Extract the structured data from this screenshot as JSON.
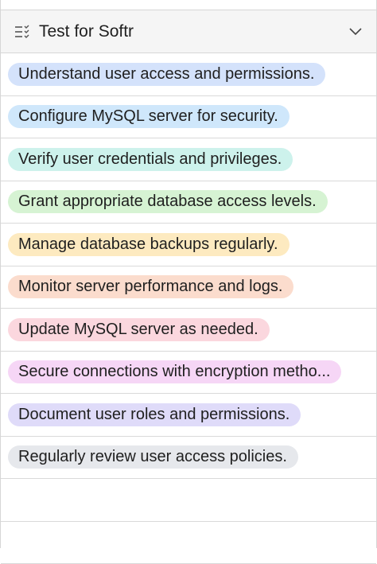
{
  "column": {
    "title": "Test for Softr",
    "icon": "multi-select-field-icon",
    "menu_icon": "chevron-down-icon"
  },
  "rows": [
    {
      "label": "Understand user access and permissions.",
      "color": "#d4e2fb"
    },
    {
      "label": "Configure MySQL server for security.",
      "color": "#cfe7fb"
    },
    {
      "label": "Verify user credentials and privileges.",
      "color": "#cdf2ec"
    },
    {
      "label": "Grant appropriate database access levels.",
      "color": "#d6f3d3"
    },
    {
      "label": "Manage database backups regularly.",
      "color": "#fdeac0"
    },
    {
      "label": "Monitor server performance and logs.",
      "color": "#fbdccd"
    },
    {
      "label": "Update MySQL server as needed.",
      "color": "#fbd7de"
    },
    {
      "label": "Secure connections with encryption metho...",
      "color": "#f6d6f6"
    },
    {
      "label": "Document user roles and permissions.",
      "color": "#dfdbf9"
    },
    {
      "label": "Regularly review user access policies.",
      "color": "#e6e8ec"
    }
  ]
}
